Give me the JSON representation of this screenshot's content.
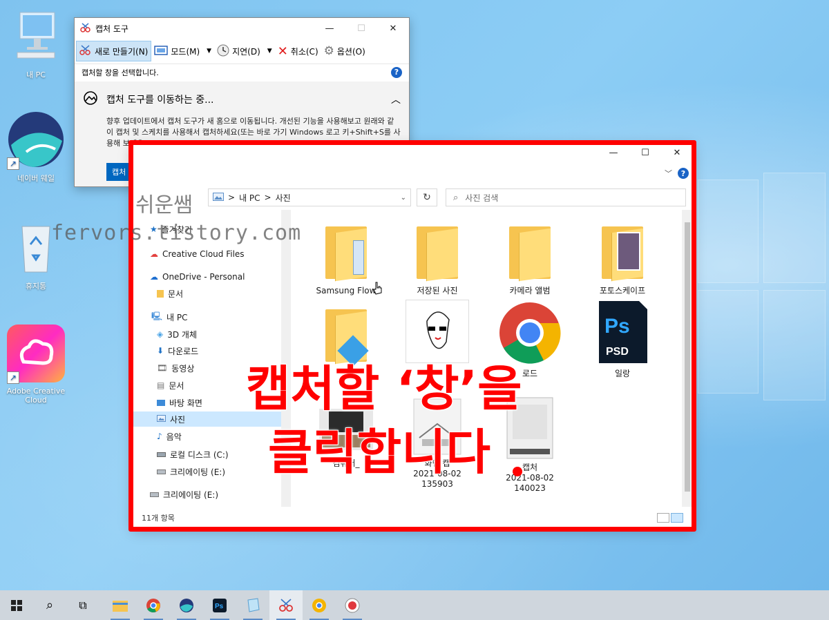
{
  "desktop": {
    "icons": [
      {
        "label": "내 PC"
      },
      {
        "label": "네이버 웨일"
      },
      {
        "label": "휴지통"
      },
      {
        "label": "Adobe Creative Cloud"
      }
    ]
  },
  "snipping_tool": {
    "title": "캡처 도구",
    "toolbar": {
      "new": "새로 만들기(N)",
      "mode": "모드(M)",
      "delay": "지연(D)",
      "cancel": "취소(C)",
      "options": "옵션(O)"
    },
    "status": "캡처할 창을 선택합니다.",
    "notice": {
      "heading": "캡처 도구를 이동하는 중...",
      "body": "향후 업데이트에서 캡처 도구가 새 홈으로 이동됩니다. 개선된 기능을 사용해보고 원래와 같이 캡처 및 스케치를 사용해서 캡처하세요(또는 바로 가기 Windows 로고 키+Shift+S를 사용해 보세요).",
      "button": "캡처 및 스케치 사용해 보기"
    }
  },
  "explorer": {
    "address": {
      "root": "내 PC",
      "sep": ">",
      "current": "사진"
    },
    "search_placeholder": "사진 검색",
    "sidebar": [
      {
        "label": "즐겨찾기",
        "icon": "star-icon"
      },
      {
        "label": "Creative Cloud Files",
        "icon": "cloud-icon"
      },
      {
        "label": "OneDrive - Personal",
        "icon": "onedrive-icon"
      },
      {
        "label": "문서",
        "icon": "folder-icon"
      },
      {
        "label": "내 PC",
        "icon": "pc-icon"
      },
      {
        "label": "3D 개체",
        "icon": "cube-icon"
      },
      {
        "label": "다운로드",
        "icon": "download-icon"
      },
      {
        "label": "동영상",
        "icon": "video-icon"
      },
      {
        "label": "문서",
        "icon": "document-icon"
      },
      {
        "label": "바탕 화면",
        "icon": "desktop-icon"
      },
      {
        "label": "사진",
        "icon": "pictures-icon"
      },
      {
        "label": "음악",
        "icon": "music-icon"
      },
      {
        "label": "로컬 디스크 (C:)",
        "icon": "disk-icon"
      },
      {
        "label": "크리에이팅 (E:)",
        "icon": "drive-icon"
      },
      {
        "label": "크리에이팅 (E:)",
        "icon": "drive-icon"
      }
    ],
    "items": [
      {
        "label": "Samsung Flow"
      },
      {
        "label": "저장된 사진"
      },
      {
        "label": "카메라 앨범"
      },
      {
        "label": "포토스케이프"
      },
      {
        "label": "일랑"
      },
      {
        "label": "컴퓨터_"
      },
      {
        "label": "화면 캡",
        "line2": "2021-08-02",
        "line3": "135903"
      },
      {
        "label": "캡처",
        "line2": "2021-08-02",
        "line3": "140023"
      },
      {
        "label": "로드"
      }
    ],
    "status": "11개 항목"
  },
  "overlay": {
    "line1": "캡처할 ‘창’을",
    "line2": "클릭합니다",
    "watermark1": "쉬운쌤",
    "watermark2": "fervors.tistory.com"
  },
  "taskbar": {
    "items": [
      "start",
      "search",
      "task-view",
      "file-explorer",
      "chrome",
      "whale",
      "photoshop",
      "notepad",
      "snipping-tool",
      "chrome-canary",
      "record"
    ]
  },
  "colors": {
    "accent": "#0067c0",
    "highlight": "#ff0000",
    "selection": "#cce8ff"
  }
}
